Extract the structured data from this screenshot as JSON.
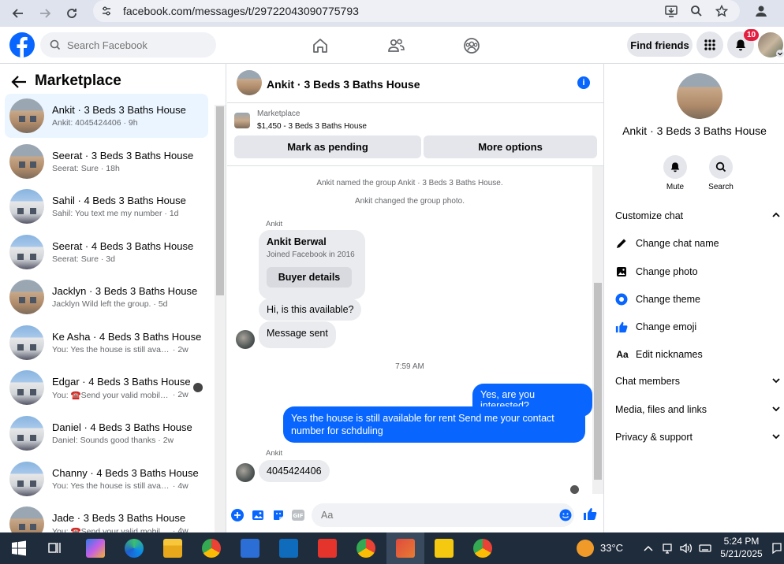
{
  "browser": {
    "url": "facebook.com/messages/t/29722043090775793"
  },
  "header": {
    "search_placeholder": "Search Facebook",
    "find_friends_label": "Find friends",
    "notification_count": "10"
  },
  "left_panel": {
    "title": "Marketplace",
    "conversations": [
      {
        "name": "Ankit · 3 Beds 3 Baths House",
        "preview": "Ankit: 4045424406",
        "time": "9h",
        "active": true
      },
      {
        "name": "Seerat · 3 Beds 3 Baths House",
        "preview": "Seerat: Sure",
        "time": "18h"
      },
      {
        "name": "Sahil · 4 Beds 3 Baths House",
        "preview": "Sahil: You text me my number",
        "time": "1d"
      },
      {
        "name": "Seerat · 4 Beds 3 Baths House",
        "preview": "Seerat: Sure",
        "time": "3d"
      },
      {
        "name": "Jacklyn · 3 Beds 3 Baths House",
        "preview": "Jacklyn Wild left the group.",
        "time": "5d"
      },
      {
        "name": "Ke Asha · 4 Beds 3 Baths House",
        "preview": "You: Yes the house is still available...",
        "time": "2w"
      },
      {
        "name": "Edgar · 4 Beds 3 Baths House",
        "preview": "You: ☎️Send your valid mobile...",
        "time": "2w"
      },
      {
        "name": "Daniel · 4 Beds 3 Baths House",
        "preview": "Daniel: Sounds good thanks",
        "time": "2w"
      },
      {
        "name": "Channy · 4 Beds 3 Baths House",
        "preview": "You: Yes the house is still available...",
        "time": "4w"
      },
      {
        "name": "Jade · 3 Beds 3 Baths House",
        "preview": "You: ☎️Send your valid mobile nu...",
        "time": "4w"
      }
    ]
  },
  "chat": {
    "title": "Ankit · 3 Beds 3 Baths House",
    "listing_category": "Marketplace",
    "listing_title": "$1,450 - 3 Beds 3 Baths House",
    "mark_pending_label": "Mark as pending",
    "more_options_label": "More options",
    "system_messages": [
      "Ankit named the group Ankit · 3 Beds 3 Baths House.",
      "Ankit changed the group photo."
    ],
    "sender_name": "Ankit",
    "card_name": "Ankit Berwal",
    "card_sub": "Joined Facebook in 2016",
    "buyer_details_label": "Buyer details",
    "msg_available": "Hi, is this available?",
    "msg_sent": "Message sent",
    "timestamp": "7:59 AM",
    "my_msg_1": "Yes, are you interested?",
    "my_msg_2": "Yes the house is still available for rent Send me your contact number for schduling",
    "sender_name_2": "Ankit",
    "msg_number": "4045424406",
    "composer_placeholder": "Aa"
  },
  "right_panel": {
    "name": "Ankit · 3 Beds 3 Baths House",
    "mute_label": "Mute",
    "search_label": "Search",
    "customize_chat": "Customize chat",
    "change_chat_name": "Change chat name",
    "change_photo": "Change photo",
    "change_theme": "Change theme",
    "change_emoji": "Change emoji",
    "edit_nicknames": "Edit nicknames",
    "chat_members": "Chat members",
    "media_files": "Media, files and links",
    "privacy_support": "Privacy & support",
    "aa_glyph": "Aa"
  },
  "taskbar": {
    "temperature": "33°C",
    "time": "5:24 PM",
    "date": "5/21/2025"
  },
  "colors": {
    "fb_blue": "#0866ff",
    "taskbar": "#1f2c3c",
    "badge_red": "#e41e3f"
  }
}
